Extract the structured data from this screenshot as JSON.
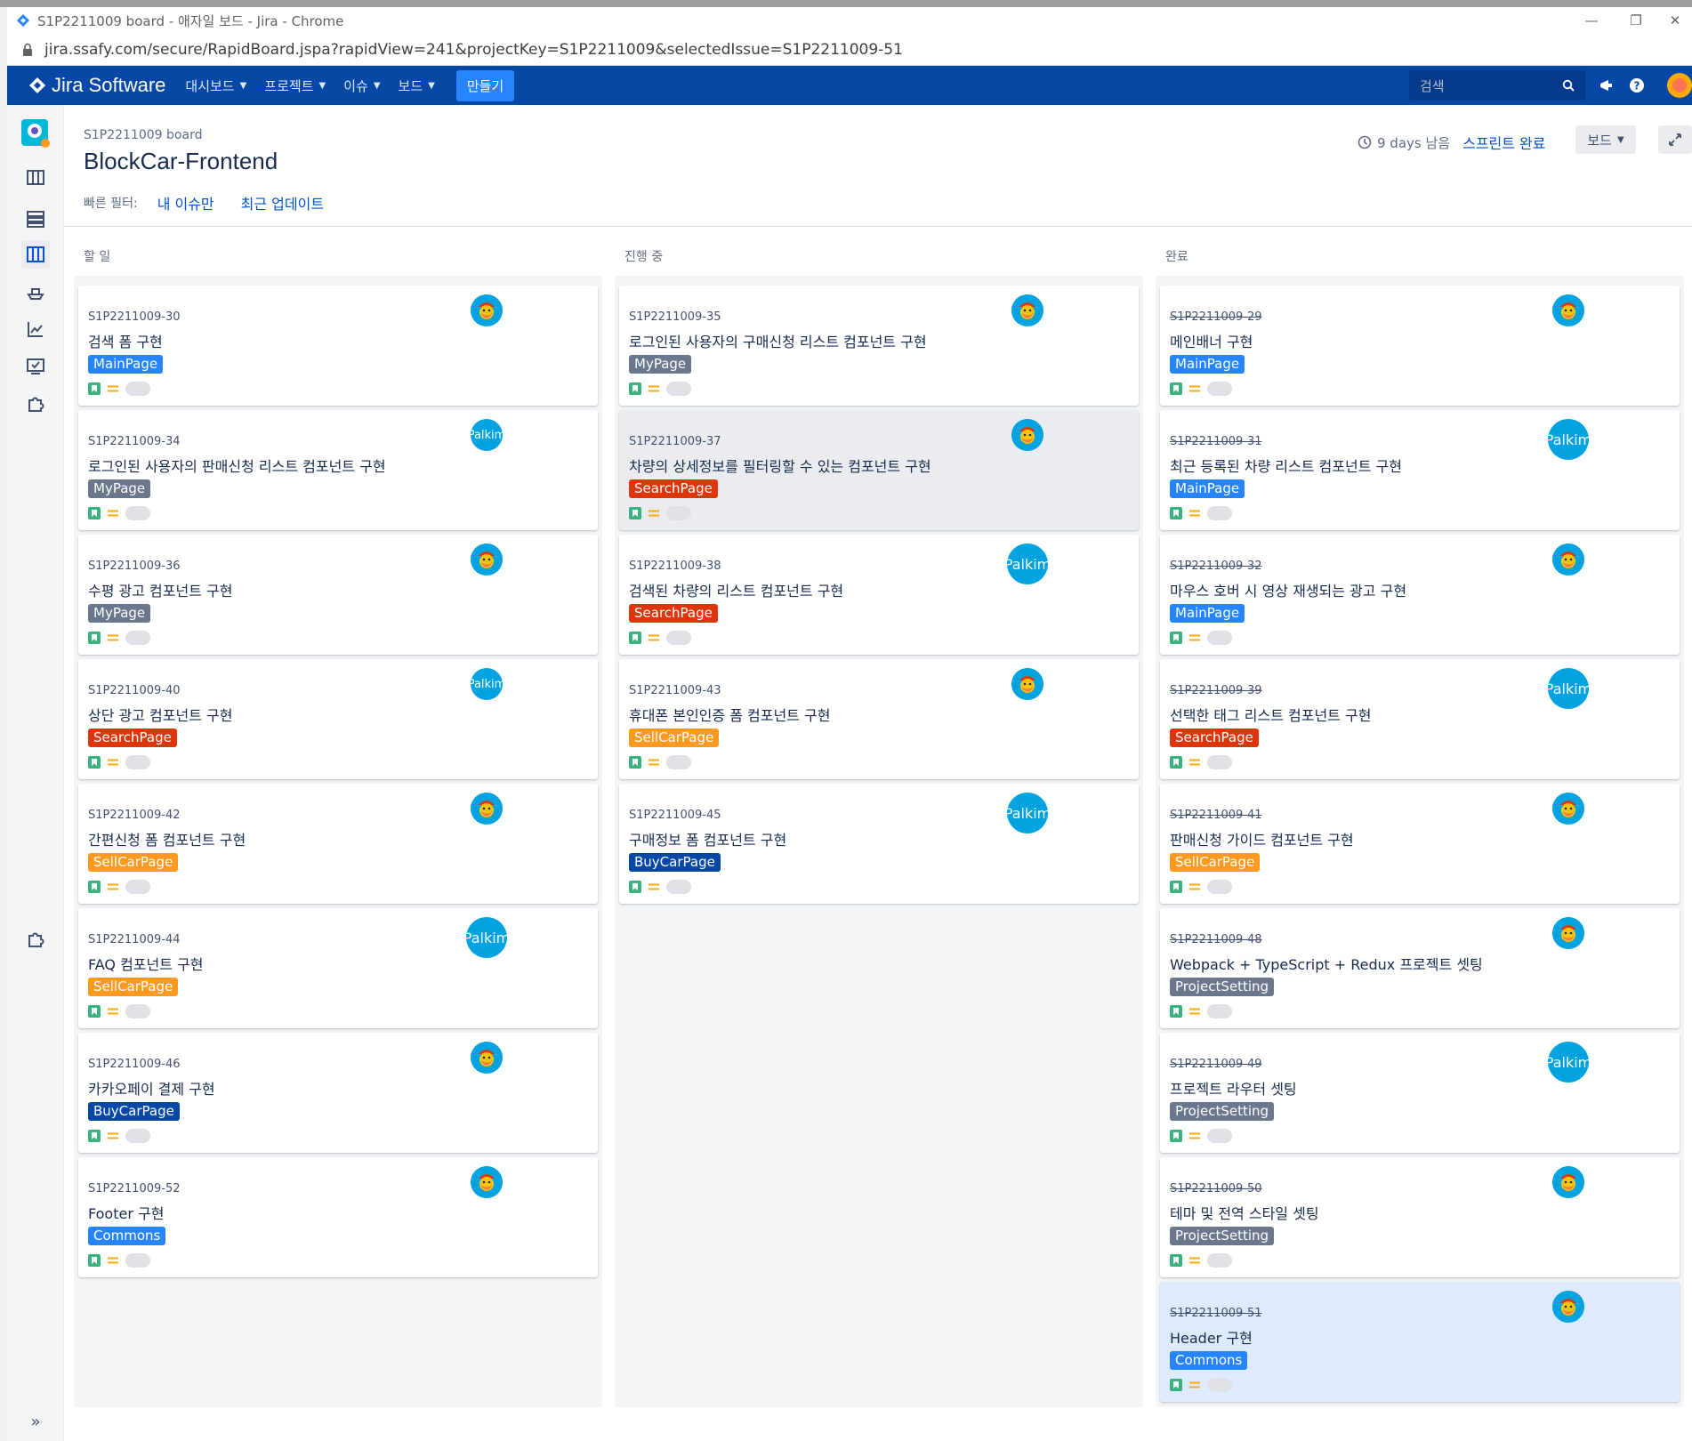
{
  "colors": {
    "nav": "#0747a6",
    "create": "#2684ff",
    "mainpage": "#2684ff",
    "mypage": "#6b778c",
    "searchpage": "#de350b",
    "sellcarpage": "#ff991f",
    "buycarpage": "#0747a6",
    "projectsetting": "#6b778c",
    "commons": "#2684ff"
  },
  "browser": {
    "tab_title": "S1P2211009 board - 애자일 보드 - Jira - Chrome",
    "url": "jira.ssafy.com/secure/RapidBoard.jspa?rapidView=241&projectKey=S1P2211009&selectedIssue=S1P2211009-51"
  },
  "nav": {
    "brand": "Jira Software",
    "menu": [
      "대시보드",
      "프로젝트",
      "이슈",
      "보드"
    ],
    "create": "만들기",
    "search_placeholder": "검색"
  },
  "header": {
    "breadcrumb": "S1P2211009 board",
    "title": "BlockCar-Frontend",
    "filter_label": "빠른 필터:",
    "filters": [
      "내 이슈만",
      "최근 업데이트"
    ],
    "sprint_days": "9 days 남음",
    "sprint_complete": "스프린트 완료",
    "board_menu": "보드"
  },
  "columns": [
    {
      "title": "할 일",
      "cards": [
        {
          "key": "S1P2211009-30",
          "summary": "검색 폼 구현",
          "epic": "MainPage",
          "epic_color": "#2684ff",
          "avatar": "face",
          "done": false,
          "highlight": ""
        },
        {
          "key": "S1P2211009-34",
          "summary": "로그인된 사용자의 판매신청 리스트 컴포넌트 구현",
          "epic": "MyPage",
          "epic_color": "#6b778c",
          "avatar": "Palkim",
          "done": false,
          "highlight": ""
        },
        {
          "key": "S1P2211009-36",
          "summary": "수평 광고 컴포넌트 구현",
          "epic": "MyPage",
          "epic_color": "#6b778c",
          "avatar": "face",
          "done": false,
          "highlight": ""
        },
        {
          "key": "S1P2211009-40",
          "summary": "상단 광고 컴포넌트 구현",
          "epic": "SearchPage",
          "epic_color": "#de350b",
          "avatar": "Palkim",
          "done": false,
          "highlight": ""
        },
        {
          "key": "S1P2211009-42",
          "summary": "간편신청 폼 컴포넌트 구현",
          "epic": "SellCarPage",
          "epic_color": "#ff991f",
          "avatar": "face",
          "done": false,
          "highlight": ""
        },
        {
          "key": "S1P2211009-44",
          "summary": "FAQ 컴포넌트 구현",
          "epic": "SellCarPage",
          "epic_color": "#ff991f",
          "avatar": "Palkim",
          "done": false,
          "highlight": "",
          "big": true
        },
        {
          "key": "S1P2211009-46",
          "summary": "카카오페이 결제 구현",
          "epic": "BuyCarPage",
          "epic_color": "#0747a6",
          "avatar": "face",
          "done": false,
          "highlight": ""
        },
        {
          "key": "S1P2211009-52",
          "summary": "Footer 구현",
          "epic": "Commons",
          "epic_color": "#2684ff",
          "avatar": "face",
          "done": false,
          "highlight": ""
        }
      ]
    },
    {
      "title": "진행 중",
      "cards": [
        {
          "key": "S1P2211009-35",
          "summary": "로그인된 사용자의 구매신청 리스트 컴포넌트 구현",
          "epic": "MyPage",
          "epic_color": "#6b778c",
          "avatar": "face",
          "done": false,
          "highlight": ""
        },
        {
          "key": "S1P2211009-37",
          "summary": "차량의 상세정보를 필터링할 수 있는 컴포넌트 구현",
          "epic": "SearchPage",
          "epic_color": "#de350b",
          "avatar": "face",
          "done": false,
          "highlight": "gray"
        },
        {
          "key": "S1P2211009-38",
          "summary": "검색된 차량의 리스트 컴포넌트 구현",
          "epic": "SearchPage",
          "epic_color": "#de350b",
          "avatar": "Palkim",
          "done": false,
          "highlight": "",
          "big": true
        },
        {
          "key": "S1P2211009-43",
          "summary": "휴대폰 본인인증 폼 컴포넌트 구현",
          "epic": "SellCarPage",
          "epic_color": "#ff991f",
          "avatar": "face",
          "done": false,
          "highlight": ""
        },
        {
          "key": "S1P2211009-45",
          "summary": "구매정보 폼 컴포넌트 구현",
          "epic": "BuyCarPage",
          "epic_color": "#0747a6",
          "avatar": "Palkim",
          "done": false,
          "highlight": "",
          "big": true
        }
      ]
    },
    {
      "title": "완료",
      "cards": [
        {
          "key": "S1P2211009-29",
          "summary": "메인배너 구현",
          "epic": "MainPage",
          "epic_color": "#2684ff",
          "avatar": "face",
          "done": true,
          "highlight": ""
        },
        {
          "key": "S1P2211009-31",
          "summary": "최근 등록된 차량 리스트 컴포넌트 구현",
          "epic": "MainPage",
          "epic_color": "#2684ff",
          "avatar": "Palkim",
          "done": true,
          "highlight": "",
          "big": true
        },
        {
          "key": "S1P2211009-32",
          "summary": "마우스 호버 시 영상 재생되는 광고 구현",
          "epic": "MainPage",
          "epic_color": "#2684ff",
          "avatar": "face",
          "done": true,
          "highlight": ""
        },
        {
          "key": "S1P2211009-39",
          "summary": "선택한 태그 리스트 컴포넌트 구현",
          "epic": "SearchPage",
          "epic_color": "#de350b",
          "avatar": "Palkim",
          "done": true,
          "highlight": "",
          "big": true
        },
        {
          "key": "S1P2211009-41",
          "summary": "판매신청 가이드 컴포넌트 구현",
          "epic": "SellCarPage",
          "epic_color": "#ff991f",
          "avatar": "face",
          "done": true,
          "highlight": ""
        },
        {
          "key": "S1P2211009-48",
          "summary": "Webpack + TypeScript + Redux 프로젝트 셋팅",
          "epic": "ProjectSetting",
          "epic_color": "#6b778c",
          "avatar": "face",
          "done": true,
          "highlight": ""
        },
        {
          "key": "S1P2211009-49",
          "summary": "프로젝트 라우터 셋팅",
          "epic": "ProjectSetting",
          "epic_color": "#6b778c",
          "avatar": "Palkim",
          "done": true,
          "highlight": "",
          "big": true
        },
        {
          "key": "S1P2211009-50",
          "summary": "테마 및 전역 스타일 셋팅",
          "epic": "ProjectSetting",
          "epic_color": "#6b778c",
          "avatar": "face",
          "done": true,
          "highlight": ""
        },
        {
          "key": "S1P2211009-51",
          "summary": "Header 구현",
          "epic": "Commons",
          "epic_color": "#2684ff",
          "avatar": "face",
          "done": true,
          "highlight": "blue"
        }
      ]
    }
  ],
  "icons": {
    "story": "bookmark-icon",
    "priority": "priority-medium-icon"
  }
}
